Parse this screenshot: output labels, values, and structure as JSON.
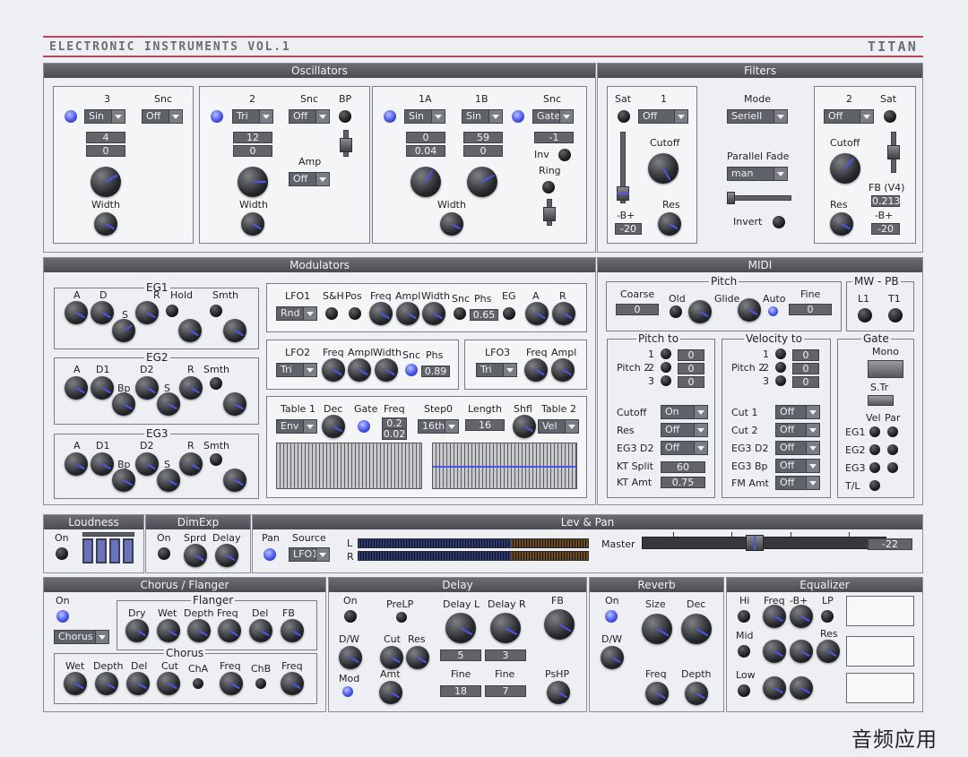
{
  "header": {
    "title": "ELECTRONIC INSTRUMENTS VOL.1",
    "brand": "TITAN"
  },
  "oscillators": {
    "title": "Oscillators",
    "osc3": {
      "name": "3",
      "snc": "Snc",
      "wave": "Sin",
      "snc_value": "Off",
      "v1": "4",
      "v2": "0",
      "width": "Width"
    },
    "osc2": {
      "name": "2",
      "snc": "Snc",
      "bp": "BP",
      "wave": "Tri",
      "snc_value": "Off",
      "v1": "12",
      "v2": "0",
      "amp": "Amp",
      "amp_value": "Off",
      "width": "Width"
    },
    "osc1": {
      "name_a": "1A",
      "name_b": "1B",
      "snc": "Snc",
      "wave_a": "Sin",
      "wave_b": "Sin",
      "snc_value": "Gate",
      "a1": "0",
      "a2": "0.04",
      "b1": "59",
      "b2": "0",
      "snc_num": "-1",
      "inv": "Inv",
      "ring": "Ring",
      "width": "Width"
    }
  },
  "filters": {
    "title": "Filters",
    "f1": {
      "sat": "Sat",
      "name": "1",
      "type": "Off",
      "cutoff": "Cutoff",
      "res": "Res",
      "bplus": "-B+",
      "bplus_value": "-20"
    },
    "mode": {
      "label": "Mode",
      "value": "Seriell",
      "parallel": "Parallel Fade",
      "parallel_value": "man",
      "invert": "Invert"
    },
    "f2": {
      "name": "2",
      "sat": "Sat",
      "type": "Off",
      "cutoff": "Cutoff",
      "res": "Res",
      "fb": "FB (V4)",
      "fb_value": "0.213",
      "bplus": "-B+",
      "bplus_value": "-20"
    }
  },
  "modulators": {
    "title": "Modulators",
    "eg1": {
      "title": "EG1",
      "a": "A",
      "d": "D",
      "s": "S",
      "r": "R",
      "hold": "Hold",
      "smth": "Smth"
    },
    "eg2": {
      "title": "EG2",
      "a": "A",
      "d1": "D1",
      "bp": "Bp",
      "d2": "D2",
      "s": "S",
      "r": "R",
      "smth": "Smth"
    },
    "eg3": {
      "title": "EG3",
      "a": "A",
      "d1": "D1",
      "bp": "Bp",
      "d2": "D2",
      "s": "S",
      "r": "R",
      "smth": "Smth"
    },
    "lfo1": {
      "title": "LFO1",
      "wave": "Rnd",
      "sh": "S&H",
      "pos": "Pos",
      "freq": "Freq",
      "ampl": "Ampl",
      "width": "Width",
      "snc": "Snc",
      "phs": "Phs",
      "phs_value": "0.65",
      "eg": "EG",
      "a": "A",
      "r": "R"
    },
    "lfo2": {
      "title": "LFO2",
      "wave": "Tri",
      "freq": "Freq",
      "ampl": "Ampl",
      "width": "Width",
      "snc": "Snc",
      "phs": "Phs",
      "phs_value": "0.89"
    },
    "lfo3": {
      "title": "LFO3",
      "wave": "Tri",
      "freq": "Freq",
      "ampl": "Ampl"
    },
    "table": {
      "table1": "Table 1",
      "table1_value": "Env",
      "dec": "Dec",
      "gate": "Gate",
      "freq": "Freq",
      "freq_v1": "0.2",
      "freq_v2": "0.02",
      "step0": "Step0",
      "step0_value": "16th",
      "length": "Length",
      "length_value": "16",
      "shfl": "Shfl",
      "table2": "Table 2",
      "table2_value": "Vel"
    }
  },
  "midi": {
    "title": "MIDI",
    "pitch": {
      "title": "Pitch",
      "coarse": "Coarse",
      "coarse_value": "0",
      "old": "Old",
      "glide": "Glide",
      "auto": "Auto",
      "fine": "Fine",
      "fine_value": "0"
    },
    "mwpb": {
      "title": "MW - PB",
      "l1": "L1",
      "t1": "T1"
    },
    "pitch_to": {
      "title": "Pitch to",
      "label": "Pitch 2",
      "rows": [
        {
          "n": "1",
          "v": "0"
        },
        {
          "n": "2",
          "v": "0"
        },
        {
          "n": "3",
          "v": "0"
        }
      ],
      "cutoff": "Cutoff",
      "cutoff_value": "On",
      "res": "Res",
      "res_value": "Off",
      "eg3d2": "EG3 D2",
      "eg3d2_value": "Off",
      "ktsplit": "KT Split",
      "ktsplit_value": "60",
      "ktamt": "KT Amt",
      "ktamt_value": "0.75"
    },
    "velocity_to": {
      "title": "Velocity to",
      "label": "Pitch 2",
      "rows": [
        {
          "n": "1",
          "v": "0"
        },
        {
          "n": "2",
          "v": "0"
        },
        {
          "n": "3",
          "v": "0"
        }
      ],
      "cut1": "Cut 1",
      "cut1_value": "Off",
      "cut2": "Cut 2",
      "cut2_value": "Off",
      "eg3d2": "EG3 D2",
      "eg3d2_value": "Off",
      "eg3bp": "EG3 Bp",
      "eg3bp_value": "Off",
      "fmamt": "FM Amt",
      "fmamt_value": "Off"
    },
    "gate": {
      "title": "Gate",
      "mono": "Mono",
      "str": "S.Tr",
      "vel": "Vel",
      "par": "Par",
      "eg1": "EG1",
      "eg2": "EG2",
      "eg3": "EG3",
      "tl": "T/L"
    }
  },
  "loudness": {
    "title": "Loudness",
    "on": "On"
  },
  "dimexp": {
    "title": "DimExp",
    "on": "On",
    "sprd": "Sprd",
    "delay": "Delay"
  },
  "levpan": {
    "title": "Lev & Pan",
    "pan": "Pan",
    "source": "Source",
    "source_value": "LFO1",
    "l": "L",
    "r": "R",
    "master": "Master",
    "master_value": "-22",
    "master_level": 0.46
  },
  "chorus": {
    "title": "Chorus / Flanger",
    "on": "On",
    "mode": "Chorus",
    "flanger": {
      "title": "Flanger",
      "dry": "Dry",
      "wet": "Wet",
      "depth": "Depth",
      "freq": "Freq",
      "del": "Del",
      "fb": "FB"
    },
    "chorus": {
      "title": "Chorus",
      "wet": "Wet",
      "depth": "Depth",
      "del": "Del",
      "cut": "Cut",
      "cha": "ChA",
      "freq": "Freq",
      "chb": "ChB",
      "freq2": "Freq"
    }
  },
  "delay": {
    "title": "Delay",
    "on": "On",
    "prelp": "PreLP",
    "delay_l": "Delay L",
    "delay_r": "Delay R",
    "fb": "FB",
    "dw": "D/W",
    "cut": "Cut",
    "res": "Res",
    "l_value": "5",
    "r_value": "3",
    "mod": "Mod",
    "amt": "Amt",
    "fine": "Fine",
    "fine2": "Fine",
    "fine_l": "18",
    "fine_r": "7",
    "pshp": "PsHP"
  },
  "reverb": {
    "title": "Reverb",
    "on": "On",
    "size": "Size",
    "dec": "Dec",
    "dw": "D/W",
    "freq": "Freq",
    "depth": "Depth"
  },
  "equalizer": {
    "title": "Equalizer",
    "hi": "Hi",
    "freq": "Freq",
    "bplus": "-B+",
    "lp": "LP",
    "mid": "Mid",
    "res": "Res",
    "low": "Low"
  },
  "watermark": "音频应用",
  "colors": {
    "accent": "#4856ea",
    "header_line": "#b7465a",
    "panel": "#eeeff2",
    "section_bar": "#55575d"
  }
}
